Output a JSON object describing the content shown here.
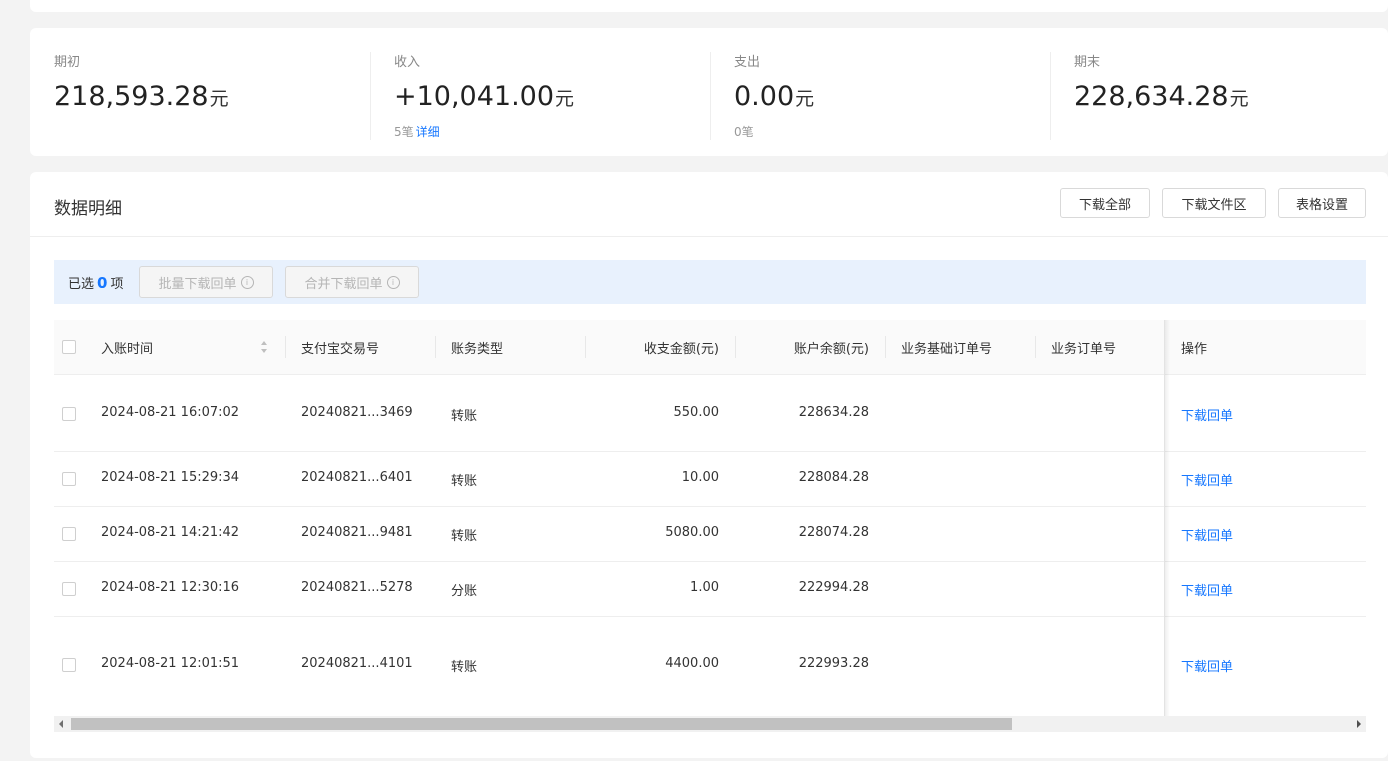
{
  "summary": {
    "opening": {
      "label": "期初",
      "value": "218,593.28",
      "unit": "元"
    },
    "income": {
      "label": "收入",
      "value": "+10,041.00",
      "unit": "元",
      "count": "5笔",
      "link": "详细"
    },
    "expense": {
      "label": "支出",
      "value": "0.00",
      "unit": "元",
      "count": "0笔"
    },
    "closing": {
      "label": "期末",
      "value": "228,634.28",
      "unit": "元"
    }
  },
  "detail": {
    "title": "数据明细",
    "buttons": {
      "download_all": "下载全部",
      "download_area": "下载文件区",
      "table_settings": "表格设置"
    }
  },
  "selection": {
    "prefix": "已选",
    "count": "0",
    "suffix": "项",
    "batch_download": "批量下载回单",
    "merge_download": "合并下载回单"
  },
  "table": {
    "columns": [
      "入账时间",
      "支付宝交易号",
      "账务类型",
      "收支金额(元)",
      "账户余额(元)",
      "业务基础订单号",
      "业务订单号",
      "操作"
    ],
    "rows": [
      {
        "time": "2024-08-21 16:07:02",
        "trade_no": "20240821...3469",
        "type": "转账",
        "amount": "550.00",
        "balance": "228634.28",
        "base_order": "",
        "order": "",
        "action": "下载回单"
      },
      {
        "time": "2024-08-21 15:29:34",
        "trade_no": "20240821...6401",
        "type": "转账",
        "amount": "10.00",
        "balance": "228084.28",
        "base_order": "",
        "order": "",
        "action": "下载回单"
      },
      {
        "time": "2024-08-21 14:21:42",
        "trade_no": "20240821...9481",
        "type": "转账",
        "amount": "5080.00",
        "balance": "228074.28",
        "base_order": "",
        "order": "",
        "action": "下载回单"
      },
      {
        "time": "2024-08-21 12:30:16",
        "trade_no": "20240821...5278",
        "type": "分账",
        "amount": "1.00",
        "balance": "222994.28",
        "base_order": "",
        "order": "",
        "action": "下载回单"
      },
      {
        "time": "2024-08-21 12:01:51",
        "trade_no": "20240821...4101",
        "type": "转账",
        "amount": "4400.00",
        "balance": "222993.28",
        "base_order": "",
        "order": "",
        "action": "下载回单"
      }
    ]
  },
  "colors": {
    "accent": "#1677ff",
    "selection_bg": "#e8f1fd",
    "page_bg": "#f3f3f3"
  }
}
